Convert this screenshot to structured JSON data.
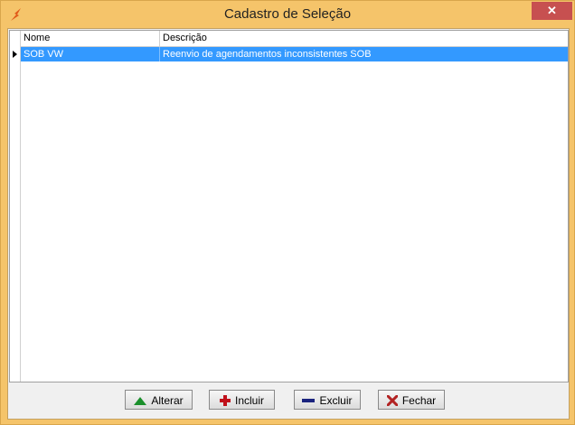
{
  "window": {
    "title": "Cadastro de Seleção",
    "close_glyph": "✕"
  },
  "grid": {
    "columns": [
      "Nome",
      "Descrição"
    ],
    "rows": [
      {
        "nome": "SOB VW",
        "descricao": "Reenvio de agendamentos inconsistentes SOB",
        "selected": true
      }
    ]
  },
  "buttons": {
    "alterar": {
      "label": "Alterar",
      "icon": "triangle-up-icon",
      "color": "#1a8f2b"
    },
    "incluir": {
      "label": "Incluir",
      "icon": "plus-icon",
      "color": "#c0101a"
    },
    "excluir": {
      "label": "Excluir",
      "icon": "minus-icon",
      "color": "#1a237e"
    },
    "fechar": {
      "label": "Fechar",
      "icon": "x-icon",
      "color": "#b22222"
    }
  },
  "colors": {
    "frame": "#f5c46a",
    "selection": "#3399ff",
    "close": "#c75050"
  }
}
